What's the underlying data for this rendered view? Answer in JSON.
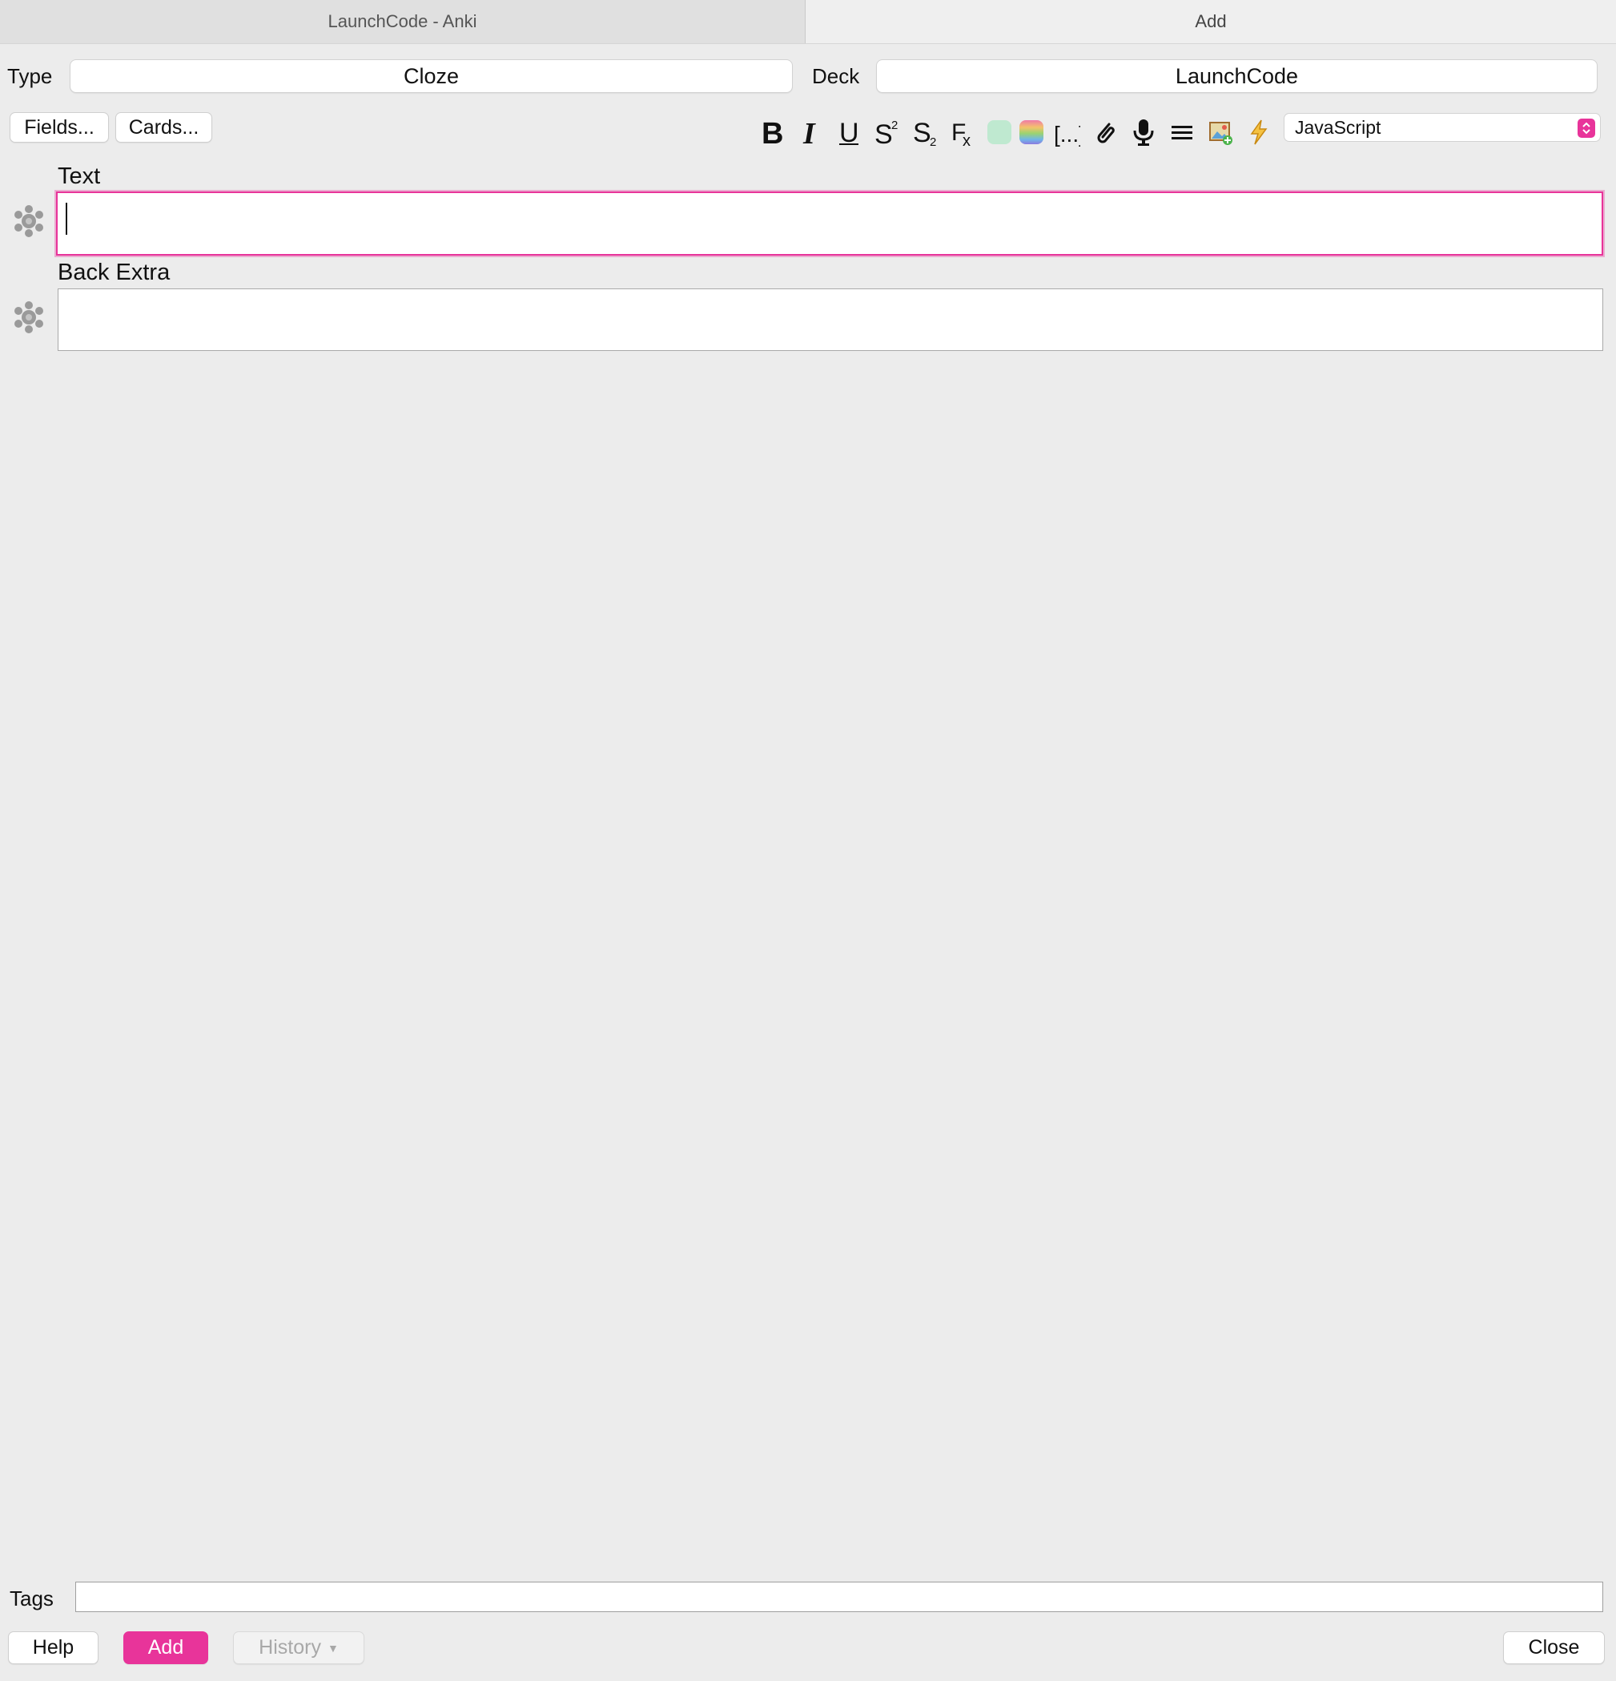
{
  "tabs": {
    "left": "LaunchCode - Anki",
    "right": "Add"
  },
  "type": {
    "label": "Type",
    "value": "Cloze"
  },
  "deck": {
    "label": "Deck",
    "value": "LaunchCode"
  },
  "buttons": {
    "fields": "Fields...",
    "cards": "Cards..."
  },
  "toolbar": {
    "icons": [
      "bold-icon",
      "italic-icon",
      "underline-icon",
      "superscript-icon",
      "subscript-icon",
      "clear-format-icon",
      "text-color-icon",
      "color-picker-icon",
      "cloze-icon",
      "attach-icon",
      "record-icon",
      "menu-icon",
      "insert-image-icon",
      "lightning-icon"
    ],
    "language_select": "JavaScript"
  },
  "fields": [
    {
      "name": "Text",
      "value": ""
    },
    {
      "name": "Back Extra",
      "value": ""
    }
  ],
  "tags": {
    "label": "Tags",
    "value": ""
  },
  "footer": {
    "help": "Help",
    "add": "Add",
    "history": "History",
    "close": "Close"
  },
  "colors": {
    "accent": "#e8349a",
    "text_color_swatch": "#bfe9d0"
  }
}
